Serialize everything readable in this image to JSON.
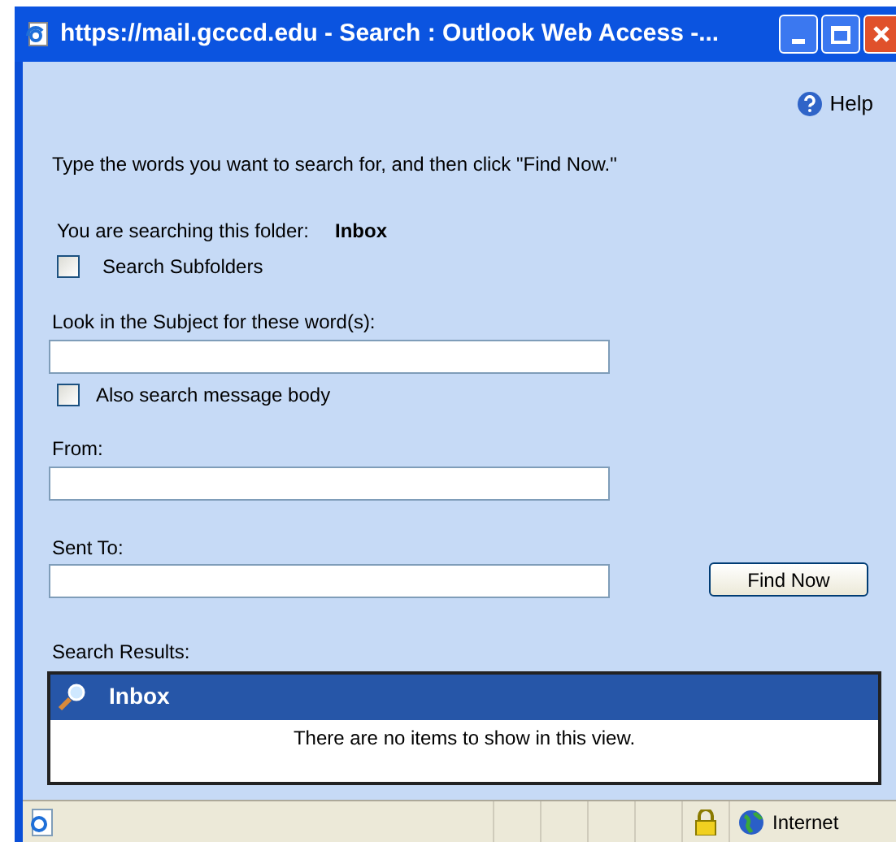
{
  "window": {
    "title": "https://mail.gcccd.edu - Search : Outlook Web Access -..."
  },
  "help": "Help",
  "instruction": "Type the words you want to search for, and then click \"Find Now.\"",
  "folder": {
    "label": "You are searching this folder:",
    "name": "Inbox"
  },
  "subfolders": {
    "label": "Search Subfolders",
    "checked": false
  },
  "subject": {
    "label": "Look in the Subject for these word(s):"
  },
  "body_option": {
    "label": "Also search message body",
    "checked": false
  },
  "from": {
    "label": "From:"
  },
  "sent_to": {
    "label": "Sent To:"
  },
  "find_button": "Find Now",
  "results": {
    "label": "Search Results:",
    "header": "Inbox",
    "empty_message": "There are no items to show in this view."
  },
  "status_bar": {
    "zone": "Internet"
  }
}
